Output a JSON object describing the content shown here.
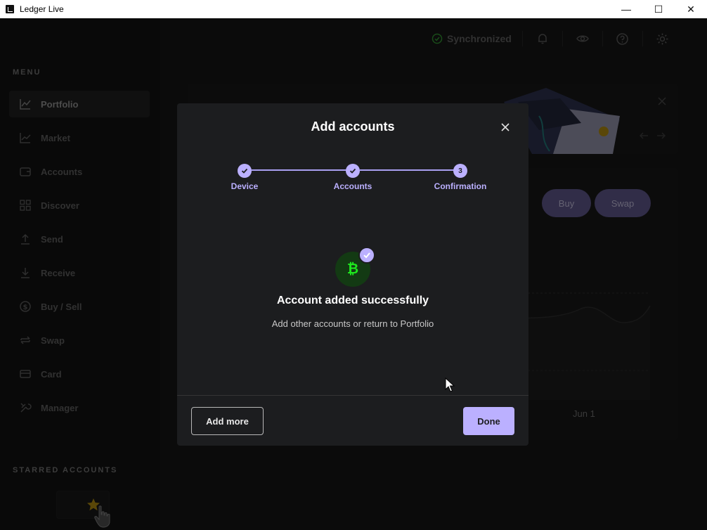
{
  "window": {
    "title": "Ledger Live",
    "minimize_glyph": "—",
    "maximize_glyph": "☐",
    "close_glyph": "✕"
  },
  "sidebar": {
    "menu_heading": "MENU",
    "items": [
      {
        "label": "Portfolio",
        "icon": "portfolio-chart-icon",
        "active": true
      },
      {
        "label": "Market",
        "icon": "market-chart-icon",
        "active": false
      },
      {
        "label": "Accounts",
        "icon": "wallet-icon",
        "active": false
      },
      {
        "label": "Discover",
        "icon": "grid-icon",
        "active": false
      },
      {
        "label": "Send",
        "icon": "arrow-up-icon",
        "active": false
      },
      {
        "label": "Receive",
        "icon": "arrow-down-icon",
        "active": false
      },
      {
        "label": "Buy / Sell",
        "icon": "dollar-icon",
        "active": false
      },
      {
        "label": "Swap",
        "icon": "swap-icon",
        "active": false
      },
      {
        "label": "Card",
        "icon": "card-icon",
        "active": false
      },
      {
        "label": "Manager",
        "icon": "tools-icon",
        "active": false
      }
    ],
    "starred_heading": "STARRED ACCOUNTS"
  },
  "topbar": {
    "sync_label": "Synchronized"
  },
  "background": {
    "buy_label": "Buy",
    "swap_label": "Swap",
    "chart_x_label": "Jun 1"
  },
  "modal": {
    "title": "Add accounts",
    "steps": [
      {
        "label": "Device",
        "state": "done"
      },
      {
        "label": "Accounts",
        "state": "done"
      },
      {
        "label": "Confirmation",
        "state": "current",
        "number": "3"
      }
    ],
    "coin_glyph": "₿",
    "success_title": "Account added successfully",
    "success_subtitle": "Add other accounts or return to Portfolio",
    "add_more_label": "Add more",
    "done_label": "Done"
  },
  "colors": {
    "accent": "#bbb0ff",
    "bitcoin_green": "#1ee81e",
    "sync_green": "#2f8a2f"
  }
}
